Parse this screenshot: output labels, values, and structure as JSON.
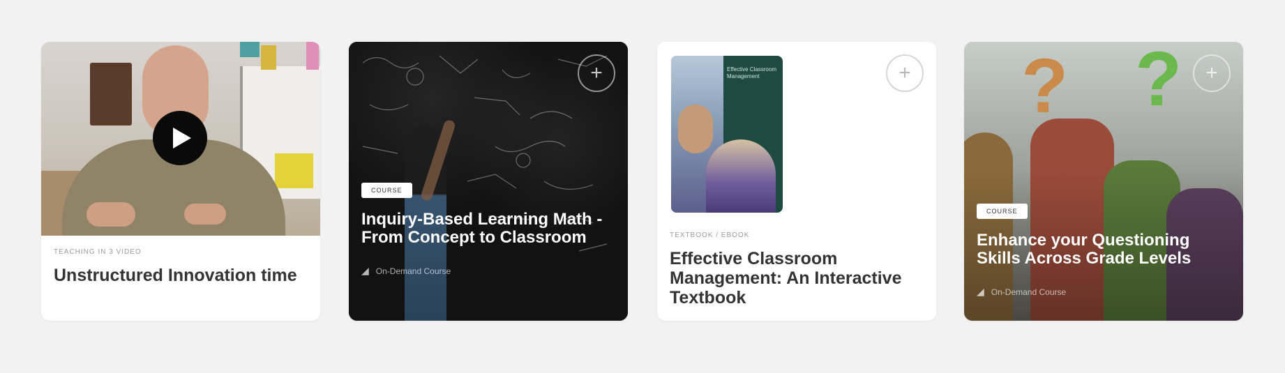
{
  "cards": [
    {
      "type": "video",
      "eyebrow": "Teaching in 3 Video",
      "title": "Unstructured Innovation time"
    },
    {
      "tag": "Course",
      "title": "Inquiry-Based Learning Math - From Concept to Classroom",
      "meta": "On-Demand Course"
    },
    {
      "eyebrow": "Textbook / eBook",
      "book_cover_text": "Effective Classroom Management",
      "title": "Effective Classroom Management: An Interactive Textbook"
    },
    {
      "tag": "Course",
      "title": "Enhance your Questioning Skills Across Grade Levels",
      "meta": "On-Demand Course"
    }
  ],
  "colors": {
    "page_bg": "#f2f2f2",
    "card_bg": "#ffffff",
    "play_button": "#0a0a0a"
  },
  "icons": [
    "play-icon",
    "plus-icon",
    "course-icon"
  ]
}
